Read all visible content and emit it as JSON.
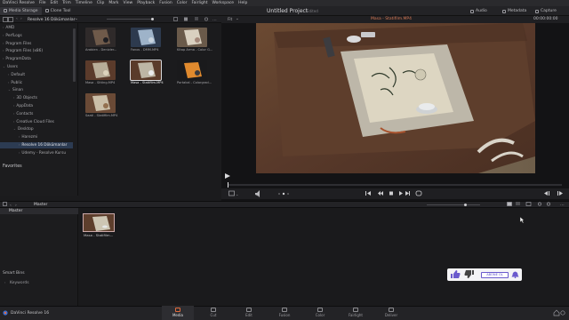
{
  "menubar": {
    "items": [
      "DaVinci Resolve",
      "File",
      "Edit",
      "Trim",
      "Timeline",
      "Clip",
      "Mark",
      "View",
      "Playback",
      "Fusion",
      "Color",
      "Fairlight",
      "Workspace",
      "Help"
    ]
  },
  "toolbar": {
    "media_storage": "Media Storage",
    "clone_tool": "Clone Tool",
    "project_title": "Untitled Project",
    "project_status": "Edited",
    "audio": "Audio",
    "metadata": "Metadata",
    "capture": "Capture"
  },
  "subbar": {
    "location": "Resolve 16 Dökümanlar",
    "fit": "Fit",
    "clip_name": "Masa - Statifilm.MP4",
    "timecode": "00:00:00:00"
  },
  "tree": {
    "items": [
      {
        "label": "AMD",
        "depth": 1,
        "chev": "›"
      },
      {
        "label": "PerfLogs",
        "depth": 1,
        "chev": "›"
      },
      {
        "label": "Program Files",
        "depth": 1,
        "chev": "›"
      },
      {
        "label": "Program Files (x86)",
        "depth": 1,
        "chev": "›"
      },
      {
        "label": "ProgramData",
        "depth": 1,
        "chev": "›"
      },
      {
        "label": "Users",
        "depth": 1,
        "chev": "⌄"
      },
      {
        "label": "Default",
        "depth": 2,
        "chev": "›"
      },
      {
        "label": "Public",
        "depth": 2,
        "chev": "›"
      },
      {
        "label": "Sinan",
        "depth": 2,
        "chev": "⌄"
      },
      {
        "label": "3D Objects",
        "depth": 3,
        "chev": "›"
      },
      {
        "label": "AppData",
        "depth": 3,
        "chev": "›"
      },
      {
        "label": "Contacts",
        "depth": 3,
        "chev": "›"
      },
      {
        "label": "Creative Cloud Files",
        "depth": 3,
        "chev": "›"
      },
      {
        "label": "Desktop",
        "depth": 3,
        "chev": "⌄"
      },
      {
        "label": "Harezmi",
        "depth": 4,
        "chev": "›"
      },
      {
        "label": "Resolve 16 Dökümanlar",
        "depth": 4,
        "chev": "›"
      },
      {
        "label": "Udemy - Resolve Kursu",
        "depth": 4,
        "chev": "›"
      }
    ],
    "favorites": "Favorites"
  },
  "thumbnails": [
    {
      "label": "Arabien - Denizler..."
    },
    {
      "label": "Fanos - DMM.MP4"
    },
    {
      "label": "Kitap Arma - Color G..."
    },
    {
      "label": "Masa - Sitting.MP4"
    },
    {
      "label": "Masa - Statifilm.MP4"
    },
    {
      "label": "Portakal - Colorgrad..."
    },
    {
      "label": "Saati - Statifilm.MP4"
    }
  ],
  "lower": {
    "master_header": "Master",
    "master_item": "Master",
    "smart_bins": "Smart Bins",
    "keywords": "Keywords",
    "pool_clip": "Masa - Statifilm..."
  },
  "pages": [
    {
      "label": "Media",
      "active": true
    },
    {
      "label": "Cut",
      "active": false
    },
    {
      "label": "Edit",
      "active": false
    },
    {
      "label": "Fusion",
      "active": false
    },
    {
      "label": "Color",
      "active": false
    },
    {
      "label": "Fairlight",
      "active": false
    },
    {
      "label": "Deliver",
      "active": false
    }
  ],
  "app_footer": "DaVinci Resolve 16",
  "youtube": {
    "subscribe": "ABONE OL"
  },
  "colors": {
    "accent": "#e06b3d",
    "selection": "#2c3b52",
    "clip_name": "#d87a56"
  }
}
